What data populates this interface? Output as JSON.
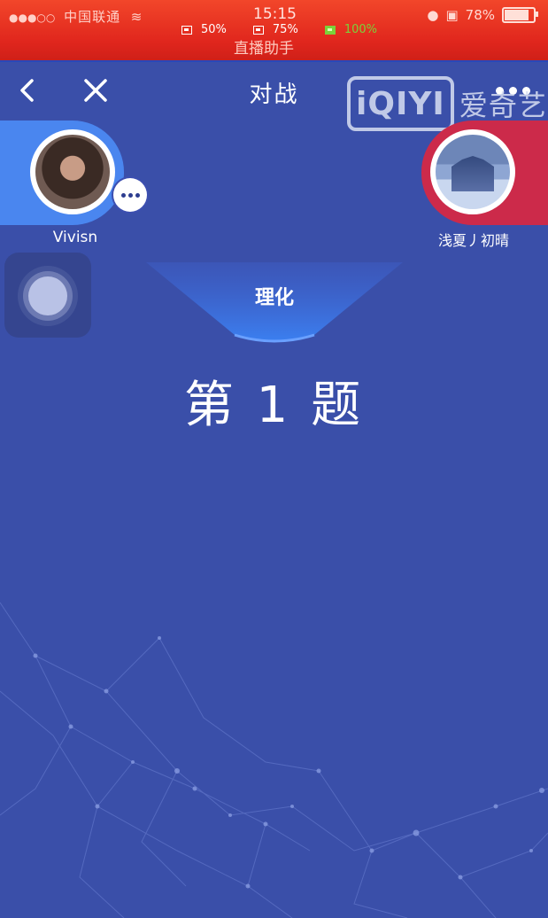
{
  "status_bar": {
    "carrier": "中国联通",
    "time": "15:15",
    "battery": "78%",
    "meters": [
      "50%",
      "75%",
      "100%"
    ],
    "app_name": "直播助手"
  },
  "nav": {
    "title": "对战"
  },
  "watermark": {
    "logo": "iQIYI",
    "text": "爱奇艺"
  },
  "players": {
    "left": {
      "name": "Vivisn"
    },
    "right": {
      "name": "浅夏丿初晴"
    }
  },
  "subject": "理化",
  "question_label": "第 1 题",
  "colors": {
    "background": "#3a4fa9",
    "left_accent": "#4a86ef",
    "right_accent": "#cc2a4a",
    "status_bar": "#e0261d"
  }
}
